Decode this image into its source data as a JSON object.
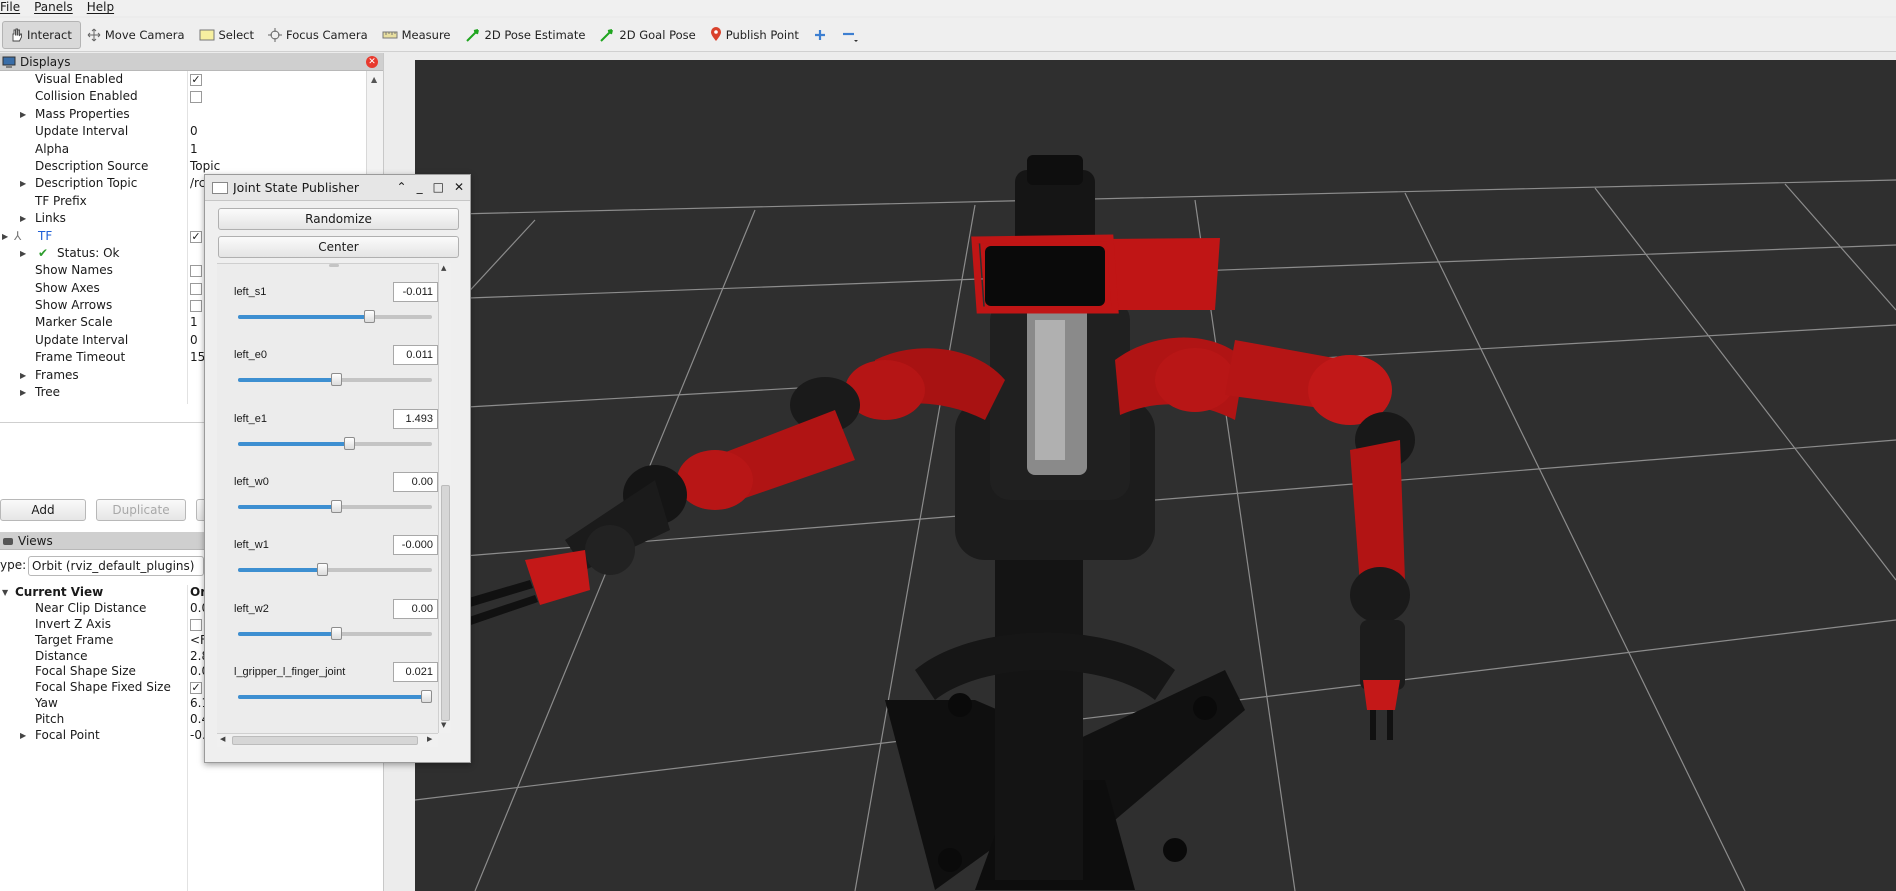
{
  "menu": [
    "File",
    "Panels",
    "Help"
  ],
  "toolbar": [
    {
      "label": "Interact",
      "icon": "hand-icon"
    },
    {
      "label": "Move Camera",
      "icon": "move-icon"
    },
    {
      "label": "Select",
      "icon": "select-icon"
    },
    {
      "label": "Focus Camera",
      "icon": "focus-icon"
    },
    {
      "label": "Measure",
      "icon": "ruler-icon"
    },
    {
      "label": "2D Pose Estimate",
      "icon": "green-arrow-icon"
    },
    {
      "label": "2D Goal Pose",
      "icon": "green-arrow-icon"
    },
    {
      "label": "Publish Point",
      "icon": "pin-icon"
    }
  ],
  "displays": {
    "title": "Displays",
    "rows": [
      {
        "label": "Visual Enabled",
        "check": "✓"
      },
      {
        "label": "Collision Enabled",
        "check": ""
      },
      {
        "label": "Mass Properties",
        "expand": true
      },
      {
        "label": "Update Interval",
        "value": "0"
      },
      {
        "label": "Alpha",
        "value": "1"
      },
      {
        "label": "Description Source",
        "value": "Topic"
      },
      {
        "label": "Description Topic",
        "value": "/rc",
        "expand": true
      },
      {
        "label": "TF Prefix"
      },
      {
        "label": "Links",
        "expand": true
      },
      {
        "label": "TF",
        "check": "✓",
        "top": true
      },
      {
        "label": "Status: Ok",
        "status": true
      },
      {
        "label": "Show Names",
        "check": ""
      },
      {
        "label": "Show Axes",
        "check": ""
      },
      {
        "label": "Show Arrows",
        "check": ""
      },
      {
        "label": "Marker Scale",
        "value": "1"
      },
      {
        "label": "Update Interval",
        "value": "0"
      },
      {
        "label": "Frame Timeout",
        "value": "15"
      },
      {
        "label": "Frames",
        "expand": true
      },
      {
        "label": "Tree",
        "expand": true
      }
    ],
    "add": "Add",
    "duplicate": "Duplicate"
  },
  "views": {
    "title": "Views",
    "type_label": "ype:",
    "type_value": "Orbit (rviz_default_plugins)",
    "rows": [
      {
        "label": "Current View",
        "value": "Or",
        "bold": true
      },
      {
        "label": "Near Clip Distance",
        "value": "0.0"
      },
      {
        "label": "Invert Z Axis",
        "check": ""
      },
      {
        "label": "Target Frame",
        "value": "<F"
      },
      {
        "label": "Distance",
        "value": "2.8"
      },
      {
        "label": "Focal Shape Size",
        "value": "0.0"
      },
      {
        "label": "Focal Shape Fixed Size",
        "check": "✓"
      },
      {
        "label": "Yaw",
        "value": "6.1"
      },
      {
        "label": "Pitch",
        "value": "0.4"
      },
      {
        "label": "Focal Point",
        "value": "-0.",
        "expand": true
      }
    ]
  },
  "dialog": {
    "title": "Joint State Publisher",
    "randomize": "Randomize",
    "center": "Center",
    "joints": [
      {
        "name": "left_s1",
        "value": "-0.011",
        "fraction": 0.69
      },
      {
        "name": "left_e0",
        "value": "0.011",
        "fraction": 0.51
      },
      {
        "name": "left_e1",
        "value": "1.493",
        "fraction": 0.58
      },
      {
        "name": "left_w0",
        "value": "0.00",
        "fraction": 0.51
      },
      {
        "name": "left_w1",
        "value": "-0.000",
        "fraction": 0.43
      },
      {
        "name": "left_w2",
        "value": "0.00",
        "fraction": 0.51
      },
      {
        "name": "l_gripper_l_finger_joint",
        "value": "0.021",
        "fraction": 1.0
      }
    ]
  },
  "colors": {
    "accent": "#3d8fd1",
    "robot_red": "#c01515",
    "viewport_bg": "#2f2f2f",
    "tf_blue": "#1f5fd6",
    "status_green": "#2e9d2e"
  }
}
